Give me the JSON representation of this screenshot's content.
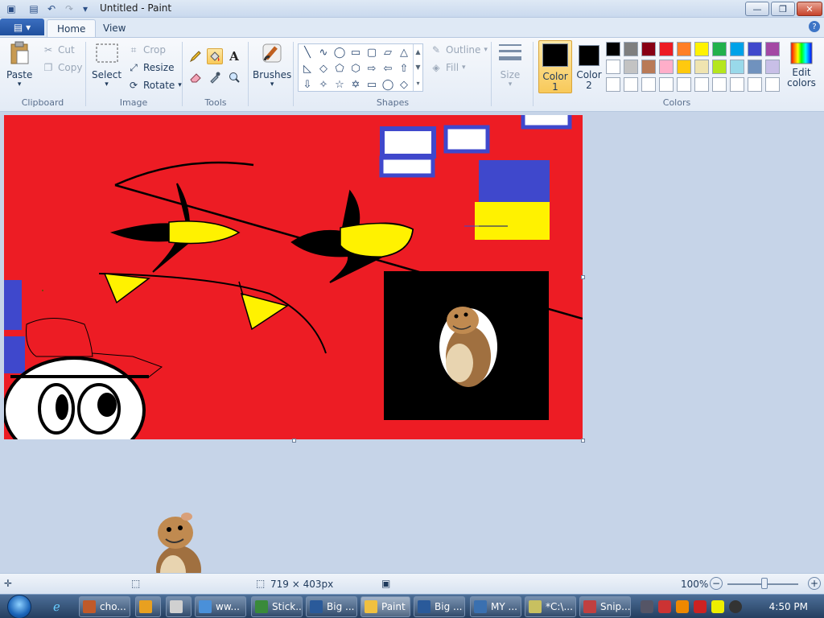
{
  "window": {
    "title": "Untitled - Paint",
    "min": "—",
    "max": "❐",
    "close": "✕"
  },
  "menu": {
    "app_button": "▾",
    "tabs": [
      "Home",
      "View"
    ],
    "help": "?"
  },
  "clipboard": {
    "paste": "Paste",
    "cut": "Cut",
    "copy": "Copy",
    "label": "Clipboard"
  },
  "image": {
    "select": "Select",
    "crop": "Crop",
    "resize": "Resize",
    "rotate": "Rotate",
    "label": "Image"
  },
  "tools": {
    "label": "Tools",
    "items": [
      "pencil-icon",
      "fill-icon",
      "text-icon",
      "eraser-icon",
      "color-picker-icon",
      "magnifier-icon"
    ],
    "text_glyph": "A"
  },
  "brushes": {
    "label": "Brushes"
  },
  "shapes": {
    "label": "Shapes",
    "outline": "Outline",
    "fill": "Fill",
    "glyphs": [
      "╲",
      "∿",
      "◯",
      "▭",
      "▢",
      "▱",
      "△",
      "◺",
      "◇",
      "⬠",
      "⬡",
      "⇨",
      "⇦",
      "⇧",
      "⇩",
      "✧",
      "☆",
      "✡",
      "▭",
      "◯",
      "◇"
    ]
  },
  "size": {
    "label": "Size"
  },
  "colors": {
    "label": "Colors",
    "color1": {
      "label": "Color 1",
      "value": "#000000"
    },
    "color2": {
      "label": "Color 2",
      "value": "#000000"
    },
    "edit": "Edit colors",
    "palette": [
      "#000000",
      "#7f7f7f",
      "#880015",
      "#ed1c24",
      "#ff7f27",
      "#fff200",
      "#22b14c",
      "#00a2e8",
      "#3f48cc",
      "#a349a4",
      "#ffffff",
      "#c3c3c3",
      "#b97a57",
      "#ffaec9",
      "#ffc90e",
      "#efe4b0",
      "#b5e61d",
      "#99d9ea",
      "#7092be",
      "#c8bfe7",
      "#ffffff",
      "#ffffff",
      "#ffffff",
      "#ffffff",
      "#ffffff",
      "#ffffff",
      "#ffffff",
      "#ffffff",
      "#ffffff",
      "#ffffff"
    ]
  },
  "canvas": {
    "background": "#ed1c24"
  },
  "status": {
    "dimensions": "719 × 403px",
    "zoom": "100%"
  },
  "taskbar": {
    "items": [
      {
        "label": "cho...",
        "color": "#c05a2a"
      },
      {
        "label": "",
        "color": "#e8a020"
      },
      {
        "label": "",
        "color": "#d0d0d0"
      },
      {
        "label": "ww...",
        "color": "#4a90d9"
      },
      {
        "label": "Stick...",
        "color": "#3a8a3a"
      },
      {
        "label": "Big ...",
        "color": "#2a5a9a"
      },
      {
        "label": "Paint",
        "color": "#f0c040"
      },
      {
        "label": "Big ...",
        "color": "#2a5a9a"
      },
      {
        "label": "MY ...",
        "color": "#3a70b0"
      },
      {
        "label": "*C:\\...",
        "color": "#c8c060"
      },
      {
        "label": "Snip...",
        "color": "#c04040"
      }
    ],
    "clock": "4:50 PM"
  }
}
